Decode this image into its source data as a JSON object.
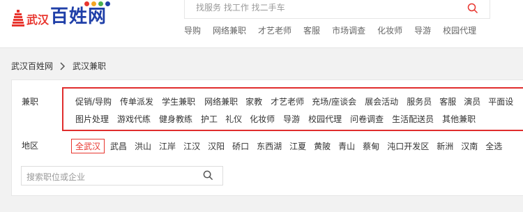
{
  "logo": {
    "city": "武汉",
    "main": "百姓网",
    "colors": [
      "#e8352e",
      "#1f3fa8",
      "#f5a623",
      "#4caf50"
    ]
  },
  "search": {
    "placeholder": "找服务 找工作 找二手车",
    "icon": "search-icon"
  },
  "hot_links": [
    "导购",
    "网络兼职",
    "才艺老师",
    "客服",
    "市场调查",
    "化妆师",
    "导游",
    "校园代理"
  ],
  "breadcrumb": {
    "home": "武汉百姓网",
    "current": "武汉兼职",
    "separator_icon": "chevron-right-icon"
  },
  "filters": {
    "category_label": "兼职",
    "categories_row1": [
      "促销/导购",
      "传单派发",
      "学生兼职",
      "网络兼职",
      "家教",
      "才艺老师",
      "充场/座谈会",
      "展会活动",
      "服务员",
      "客服",
      "演员",
      "平面设"
    ],
    "categories_row2": [
      "图片处理",
      "游戏代练",
      "健身教练",
      "护工",
      "礼仪",
      "化妆师",
      "导游",
      "校园代理",
      "问卷调查",
      "生活配送员",
      "其他兼职"
    ],
    "district_label": "地区",
    "districts": [
      "全武汉",
      "武昌",
      "洪山",
      "江岸",
      "江汉",
      "汉阳",
      "硚口",
      "东西湖",
      "江夏",
      "黄陂",
      "青山",
      "蔡甸",
      "沌口开发区",
      "新洲",
      "汉南",
      "全选"
    ],
    "selected_district": "全武汉",
    "highlight_color": "#e02d2d"
  },
  "keyword_search": {
    "placeholder": "搜索职位或企业",
    "icon": "search-icon"
  }
}
